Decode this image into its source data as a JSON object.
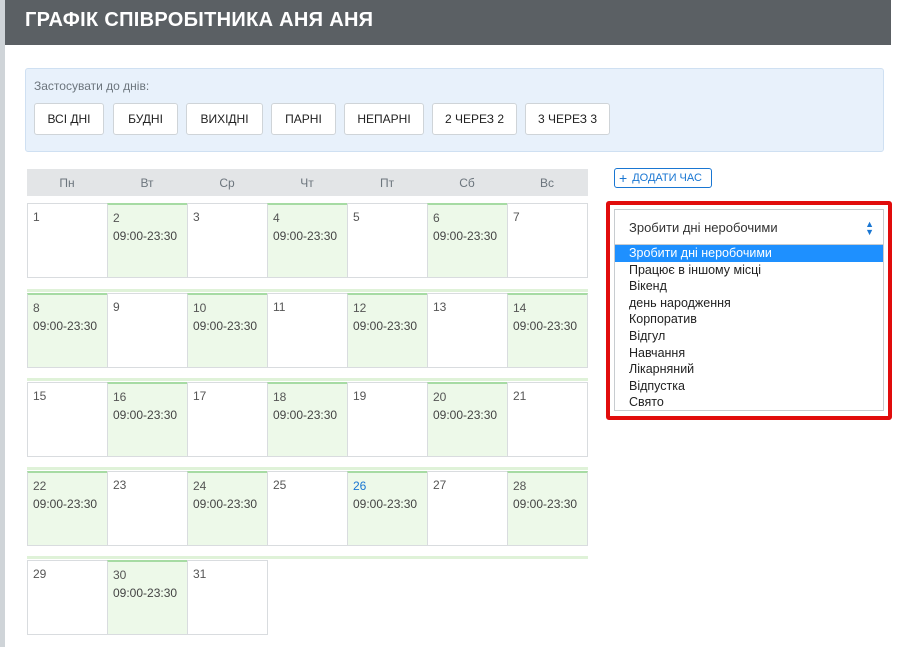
{
  "header": {
    "title": "ГРАФІК СПІВРОБІТНИКА АНЯ АНЯ"
  },
  "apply": {
    "label": "Застосувати до днів:",
    "buttons": [
      "ВСІ ДНІ",
      "БУДНІ",
      "ВИХІДНІ",
      "ПАРНІ",
      "НЕПАРНІ",
      "2 ЧЕРЕЗ 2",
      "3 ЧЕРЕЗ 3"
    ]
  },
  "calendar": {
    "weekdays": [
      "Пн",
      "Вт",
      "Ср",
      "Чт",
      "Пт",
      "Сб",
      "Вс"
    ],
    "work_hours": "09:00-23:30",
    "weeks": [
      [
        {
          "n": "1",
          "w": false
        },
        {
          "n": "2",
          "w": true
        },
        {
          "n": "3",
          "w": false
        },
        {
          "n": "4",
          "w": true
        },
        {
          "n": "5",
          "w": false
        },
        {
          "n": "6",
          "w": true
        },
        {
          "n": "7",
          "w": false
        }
      ],
      [
        {
          "n": "8",
          "w": true
        },
        {
          "n": "9",
          "w": false
        },
        {
          "n": "10",
          "w": true
        },
        {
          "n": "11",
          "w": false
        },
        {
          "n": "12",
          "w": true
        },
        {
          "n": "13",
          "w": false
        },
        {
          "n": "14",
          "w": true
        }
      ],
      [
        {
          "n": "15",
          "w": false
        },
        {
          "n": "16",
          "w": true
        },
        {
          "n": "17",
          "w": false
        },
        {
          "n": "18",
          "w": true
        },
        {
          "n": "19",
          "w": false
        },
        {
          "n": "20",
          "w": true
        },
        {
          "n": "21",
          "w": false
        }
      ],
      [
        {
          "n": "22",
          "w": true
        },
        {
          "n": "23",
          "w": false
        },
        {
          "n": "24",
          "w": true
        },
        {
          "n": "25",
          "w": false
        },
        {
          "n": "26",
          "w": true,
          "today": true
        },
        {
          "n": "27",
          "w": false
        },
        {
          "n": "28",
          "w": true
        }
      ],
      [
        {
          "n": "29",
          "w": false
        },
        {
          "n": "30",
          "w": true
        },
        {
          "n": "31",
          "w": false
        }
      ]
    ]
  },
  "add_time": {
    "label": "ДОДАТИ ЧАС",
    "icon": "plus-icon"
  },
  "dropdown": {
    "selected": "Зробити дні неробочими",
    "options": [
      "Зробити дні неробочими",
      "Працює в іншому місці",
      "Вікенд",
      "день народження",
      "Корпоратив",
      "Відгул",
      "Навчання",
      "Лікарняний",
      "Відпустка",
      "Свято"
    ]
  },
  "colors": {
    "header": "#5b6064",
    "work_day": "#edf9e9",
    "accent": "#1976d2",
    "highlight": "#e10c0c",
    "option_selected": "#1e90ff"
  }
}
